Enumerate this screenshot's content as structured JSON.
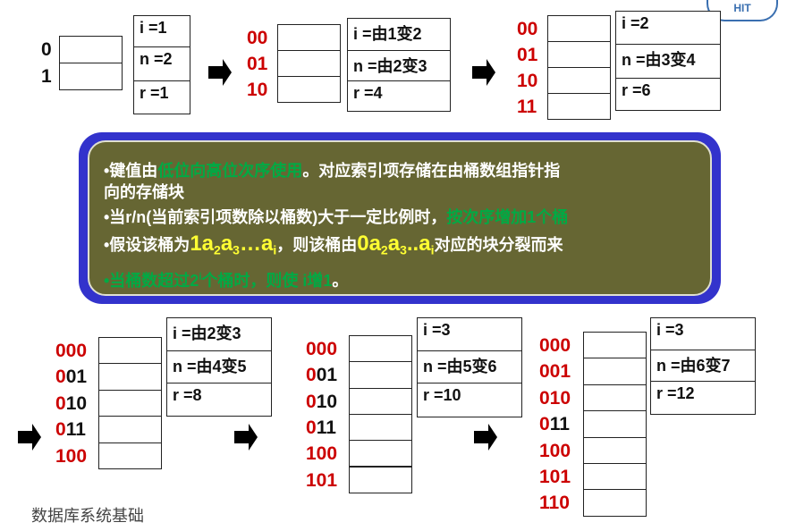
{
  "logo_text": "HIT",
  "colors": {
    "label_red": "#cc0000",
    "box_blue": "#3333cc",
    "box_olive": "#666633",
    "highlight_green": "#00aa44",
    "highlight_yellow": "#ffff33"
  },
  "panels": [
    {
      "labels": [
        [
          "",
          "0"
        ],
        [
          "",
          "1"
        ]
      ],
      "info": [
        "i =1",
        "n =2",
        "r =1"
      ]
    },
    {
      "labels": [
        [
          "00",
          ""
        ],
        [
          "01",
          ""
        ],
        [
          "10",
          ""
        ]
      ],
      "info": [
        "i =由1变2",
        "n =由2变3",
        "r =4"
      ]
    },
    {
      "labels": [
        [
          "00",
          ""
        ],
        [
          "01",
          ""
        ],
        [
          "10",
          ""
        ],
        [
          "11",
          ""
        ]
      ],
      "info": [
        "i =2",
        "n =由3变4",
        "r =6"
      ]
    },
    {
      "labels": [
        [
          "000",
          ""
        ],
        [
          "0",
          "01"
        ],
        [
          "0",
          "10"
        ],
        [
          "0",
          "11"
        ],
        [
          "100",
          ""
        ]
      ],
      "info": [
        "i =由2变3",
        "n =由4变5",
        "r =8"
      ]
    },
    {
      "labels": [
        [
          "000",
          ""
        ],
        [
          "0",
          "01"
        ],
        [
          "0",
          "10"
        ],
        [
          "0",
          "11"
        ],
        [
          "100",
          ""
        ],
        [
          "101",
          ""
        ]
      ],
      "info": [
        "i =3",
        "n =由5变6",
        "r =10"
      ]
    },
    {
      "labels": [
        [
          "000",
          ""
        ],
        [
          "001",
          ""
        ],
        [
          "010",
          ""
        ],
        [
          "0",
          "11"
        ],
        [
          "100",
          ""
        ],
        [
          "101",
          ""
        ],
        [
          "110",
          ""
        ]
      ],
      "info": [
        "i =3",
        "n =由6变7",
        "r =12"
      ]
    }
  ],
  "notes": {
    "l1a": "•键值由",
    "l1g": "低位向高位次序使用",
    "l1b": "。对应索引项存储在由桶数组指针指",
    "l1c": "向的存储块",
    "l2a": "•当r/n(当前索引项数除以桶数)大于一定比例时，",
    "l2g": "按次序增加1个桶",
    "l3a": "•假设该桶为",
    "l3y1": "1a",
    "l3s1": "2",
    "l3y2": "a",
    "l3s2": "3",
    "l3y3": "…a",
    "l3s3": "i",
    "l3b": "，则该桶由",
    "l3y4": "0a",
    "l3s4": "2",
    "l3y5": "a",
    "l3s5": "3",
    "l3y6": "..a",
    "l3s6": "i",
    "l3c": "对应的块分裂而来",
    "l4g": "•当桶数超过2",
    "l4s": "i",
    "l4g2": "个桶时，则使 i增1",
    "l4b": "。"
  },
  "footer": "数据库系统基础"
}
